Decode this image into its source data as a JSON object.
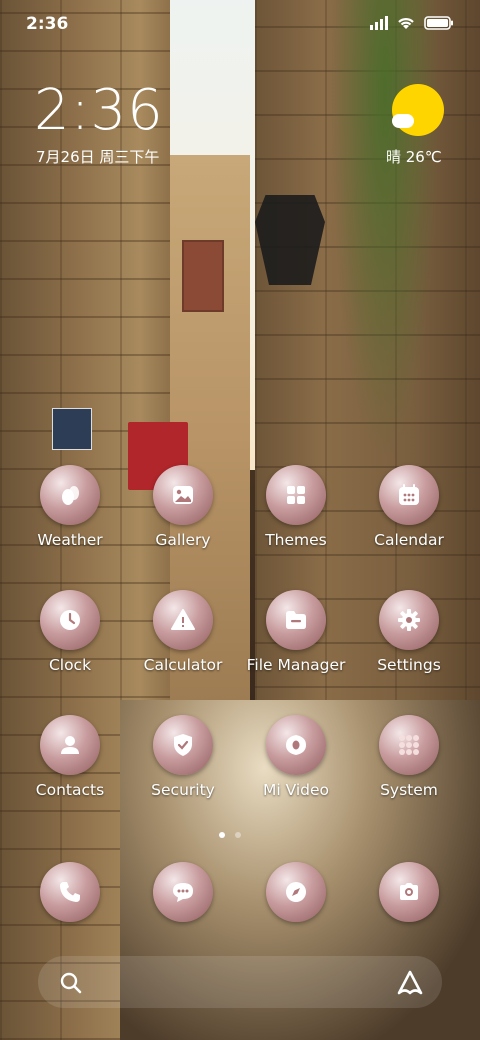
{
  "status_bar": {
    "time": "2:36"
  },
  "clock_widget": {
    "time": "2:36",
    "date": "7月26日 周三下午",
    "weather": "晴 26℃"
  },
  "apps": [
    {
      "label": "Weather",
      "icon": "weather-drops-icon"
    },
    {
      "label": "Gallery",
      "icon": "gallery-icon"
    },
    {
      "label": "Themes",
      "icon": "themes-grid-icon"
    },
    {
      "label": "Calendar",
      "icon": "calendar-icon"
    },
    {
      "label": "Clock",
      "icon": "clock-icon"
    },
    {
      "label": "Calculator",
      "icon": "calculator-icon"
    },
    {
      "label": "File Manager",
      "icon": "folder-icon"
    },
    {
      "label": "Settings",
      "icon": "gear-icon"
    },
    {
      "label": "Contacts",
      "icon": "person-icon"
    },
    {
      "label": "Security",
      "icon": "shield-icon"
    },
    {
      "label": "Mi Video",
      "icon": "video-icon"
    },
    {
      "label": "System",
      "icon": "folder-grid-icon"
    }
  ],
  "dock": [
    {
      "icon": "phone-icon"
    },
    {
      "icon": "messages-icon"
    },
    {
      "icon": "compass-icon"
    },
    {
      "icon": "camera-icon"
    }
  ],
  "page_indicator": {
    "pages": 2,
    "current": 1
  },
  "colors": {
    "icon_base": "#b88a8d",
    "sun": "#ffd500",
    "label": "#ffffff"
  }
}
